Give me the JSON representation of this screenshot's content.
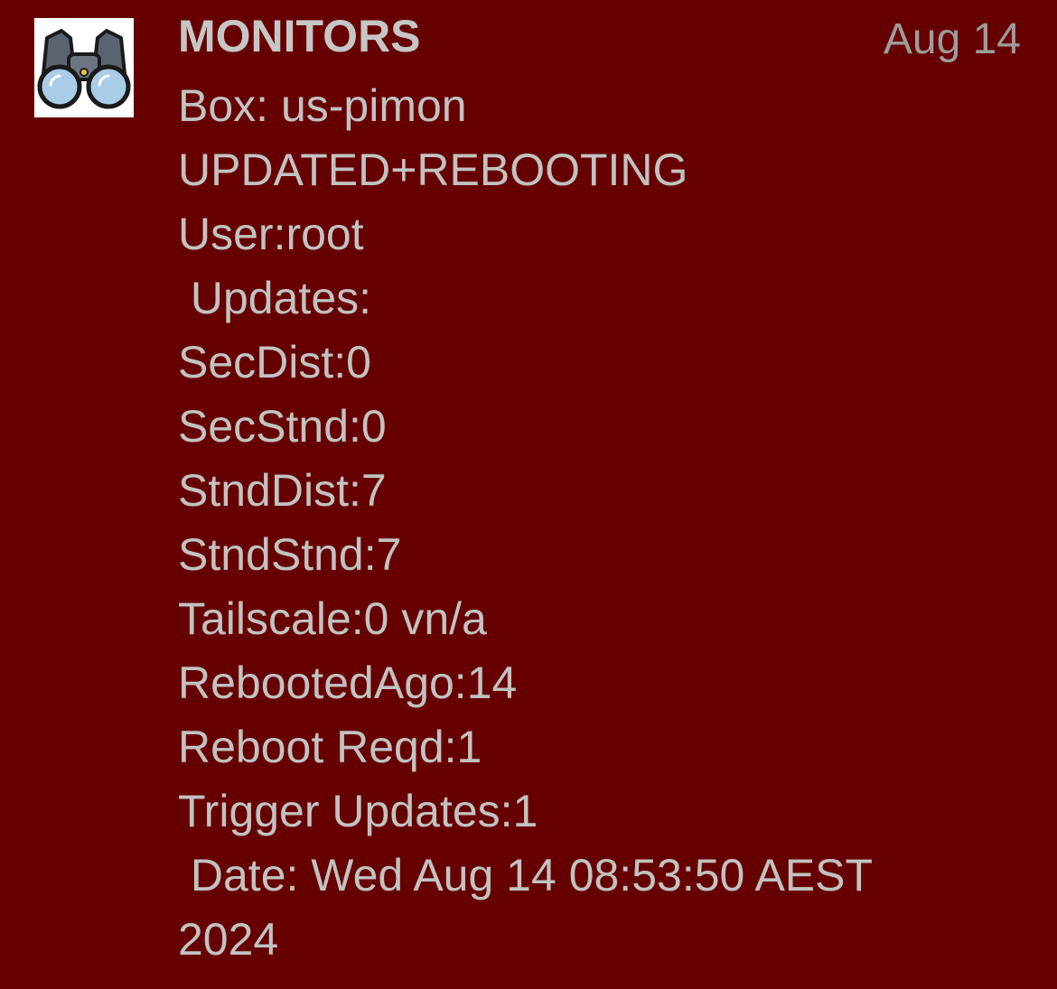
{
  "notification": {
    "icon": "binoculars-icon",
    "sender": "MONITORS",
    "date": "Aug 14",
    "lines": [
      "Box: us-pimon",
      "UPDATED+REBOOTING",
      "User:root",
      " Updates:",
      "SecDist:0",
      "SecStnd:0",
      "StndDist:7",
      "StndStnd:7",
      "Tailscale:0 vn/a",
      "RebootedAgo:14",
      "Reboot Reqd:1",
      "Trigger Updates:1",
      " Date: Wed Aug 14 08:53:50 AEST",
      "2024"
    ]
  },
  "colors": {
    "background": "#660000",
    "text": "#c2c2c2",
    "date_text": "#9c9c9c"
  }
}
